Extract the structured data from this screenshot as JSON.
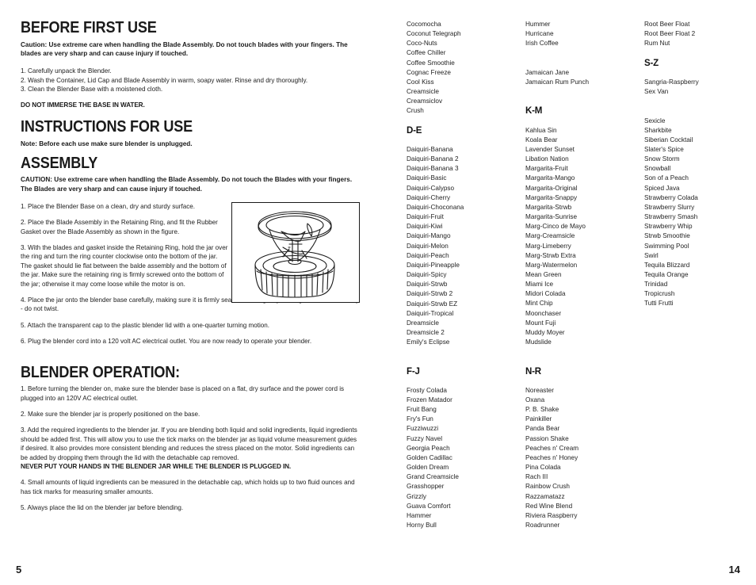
{
  "left_page": {
    "page_number": "5",
    "sections": [
      {
        "heading": "BEFORE FIRST USE",
        "caution": "Caution:  Use extreme care when handling the Blade Assembly.  Do not touch blades with your fingers. The blades are very sharp and can cause injury if touched.",
        "steps": [
          "1. Carefully unpack the Blender.",
          "2. Wash the Container, Lid Cap and Blade Assembly in warm, soapy water.  Rinse and dry thoroughly.",
          "3. Clean the Blender Base with a moistened cloth."
        ],
        "warning": "DO NOT IMMERSE THE BASE IN WATER."
      },
      {
        "heading": "INSTRUCTIONS FOR USE",
        "note": "Note:  Before each use make sure blender is unplugged."
      },
      {
        "heading": "ASSEMBLY",
        "caution": "CAUTION:   Use extreme care when handling the Blade Assembly.  Do not touch the Blades with your fingers.  The Blades are very sharp and can cause injury if touched.",
        "steps": [
          "1. Place the Blender Base on a clean, dry and sturdy surface.",
          "2. Place the Blade Assembly in the Retaining Ring, and fit the Rubber Gasket over the Blade Assembly as shown in the figure.",
          "3. With the blades and gasket inside the Retaining Ring, hold the jar over the ring and turn the ring counter clockwise onto the bottom of the jar. The gasket should lie flat between the balde assembly and the bottom of the jar.  Make sure the retaining ring is firmly screwed onto the bottom of the jar; otherwise it may come loose while the motor is on.",
          "4. Place the jar onto the blender base carefully, making sure it is firmly seated.  Use a gently rocking motion if necessary - do not twist.",
          "5. Attach the transparent cap to the plastic blender lid with a one-quarter turning motion.",
          "6. Plug the blender cord into a 120 volt AC electrical outlet.  You are now ready to operate your blender."
        ],
        "figure_caption": "blade-assembly-retaining-ring-gasket"
      },
      {
        "heading": "BLENDER OPERATION:",
        "steps": [
          "1.  Before turning the blender on, make sure the blender base is placed on a flat, dry surface and the power cord is plugged into an 120V AC electrical outlet.",
          "2.  Make sure the blender jar is properly positioned on the base.",
          "3.  Add the required ingredients to the blender jar. If you are blending both liquid and solid ingredients, liquid ingredients should be added first. This will allow you to use the tick marks on the blender jar as liquid volume measurement guides if desired. It also provides more consistent blending and reduces the stress placed on the motor. Solid ingredients can be added by dropping them through the lid with the detachable cap removed.",
          "4.  Small amounts of liquid ingredients can be measured in the detachable cap, which holds up to two fluid ounces and has tick marks for measuring smaller amounts.",
          "5.  Always place the lid on the blender jar before blending."
        ],
        "emphasis": "NEVER PUT YOUR HANDS IN THE BLENDER JAR WHILE THE BLENDER IS PLUGGED IN."
      }
    ]
  },
  "right_page": {
    "page_number": "14",
    "columns": [
      {
        "entries": [
          {
            "type": "drink",
            "text": "Cocomocha"
          },
          {
            "type": "drink",
            "text": "Coconut Telegraph"
          },
          {
            "type": "drink",
            "text": "Coco-Nuts"
          },
          {
            "type": "drink",
            "text": "Coffee Chiller"
          },
          {
            "type": "drink",
            "text": "Coffee Smoothie"
          },
          {
            "type": "drink",
            "text": "Cognac Freeze"
          },
          {
            "type": "drink",
            "text": "Cool Kiss"
          },
          {
            "type": "drink",
            "text": "Creamsicle"
          },
          {
            "type": "drink",
            "text": "Creamsiclov"
          },
          {
            "type": "drink",
            "text": "Crush"
          },
          {
            "type": "spacer"
          },
          {
            "type": "heading",
            "text": "D-E"
          },
          {
            "type": "spacer"
          },
          {
            "type": "drink",
            "text": "Daiquiri-Banana"
          },
          {
            "type": "drink",
            "text": "Daiquiri-Banana 2"
          },
          {
            "type": "drink",
            "text": "Daiquiri-Banana 3"
          },
          {
            "type": "drink",
            "text": "Daiquiri-Basic"
          },
          {
            "type": "drink",
            "text": "Daiquiri-Calypso"
          },
          {
            "type": "drink",
            "text": "Daiquiri-Cherry"
          },
          {
            "type": "drink",
            "text": "Daiquiri-Choconana"
          },
          {
            "type": "drink",
            "text": "Daiquiri-Fruit"
          },
          {
            "type": "drink",
            "text": "Daiquiri-Kiwi"
          },
          {
            "type": "drink",
            "text": "Daiquiri-Mango"
          },
          {
            "type": "drink",
            "text": "Daiquiri-Melon"
          },
          {
            "type": "drink",
            "text": "Daiquiri-Peach"
          },
          {
            "type": "drink",
            "text": "Daiquiri-Pineapple"
          },
          {
            "type": "drink",
            "text": "Daiquiri-Spicy"
          },
          {
            "type": "drink",
            "text": "Daiquiri-Strwb"
          },
          {
            "type": "drink",
            "text": "Daiquiri-Strwb 2"
          },
          {
            "type": "drink",
            "text": "Daiquiri-Strwb EZ"
          },
          {
            "type": "drink",
            "text": "Daiquiri-Tropical"
          },
          {
            "type": "drink",
            "text": "Dreamsicle"
          },
          {
            "type": "drink",
            "text": "Dreamsicle 2"
          },
          {
            "type": "drink",
            "text": "Emily's Eclipse"
          },
          {
            "type": "spacer"
          },
          {
            "type": "spacer"
          },
          {
            "type": "heading",
            "text": "F-J"
          },
          {
            "type": "spacer"
          },
          {
            "type": "drink",
            "text": "Frosty Colada"
          },
          {
            "type": "drink",
            "text": "Frozen Matador"
          },
          {
            "type": "drink",
            "text": "Fruit Bang"
          },
          {
            "type": "drink",
            "text": "Fry's Fun"
          },
          {
            "type": "drink",
            "text": "Fuzziwuzzi"
          },
          {
            "type": "drink",
            "text": "Fuzzy Navel"
          },
          {
            "type": "drink",
            "text": "Georgia Peach"
          },
          {
            "type": "drink",
            "text": "Golden Cadillac"
          },
          {
            "type": "drink",
            "text": "Golden Dream"
          },
          {
            "type": "drink",
            "text": "Grand Creamsicle"
          },
          {
            "type": "drink",
            "text": "Grasshopper"
          },
          {
            "type": "drink",
            "text": "Grizzly"
          },
          {
            "type": "drink",
            "text": "Guava Comfort"
          },
          {
            "type": "drink",
            "text": "Hammer"
          },
          {
            "type": "drink",
            "text": "Horny Bull"
          }
        ]
      },
      {
        "entries": [
          {
            "type": "drink",
            "text": "Hummer"
          },
          {
            "type": "drink",
            "text": "Hurricane"
          },
          {
            "type": "drink",
            "text": "Irish Coffee"
          },
          {
            "type": "spacer"
          },
          {
            "type": "spacer"
          },
          {
            "type": "drink",
            "text": "Jamaican Jane"
          },
          {
            "type": "drink",
            "text": "Jamaican Rum Punch"
          },
          {
            "type": "spacer"
          },
          {
            "type": "spacer"
          },
          {
            "type": "heading",
            "text": "K-M"
          },
          {
            "type": "spacer"
          },
          {
            "type": "drink",
            "text": "Kahlua Sin"
          },
          {
            "type": "drink",
            "text": "Koala Bear"
          },
          {
            "type": "drink",
            "text": "Lavender Sunset"
          },
          {
            "type": "drink",
            "text": "Libation Nation"
          },
          {
            "type": "drink",
            "text": "Margarita-Fruit"
          },
          {
            "type": "drink",
            "text": "Margarita-Mango"
          },
          {
            "type": "drink",
            "text": "Margarita-Original"
          },
          {
            "type": "drink",
            "text": "Margarita-Snappy"
          },
          {
            "type": "drink",
            "text": "Margarita-Strwb"
          },
          {
            "type": "drink",
            "text": "Margarita-Sunrise"
          },
          {
            "type": "drink",
            "text": "Marg-Cinco de Mayo"
          },
          {
            "type": "drink",
            "text": "Marg-Creamsicle"
          },
          {
            "type": "drink",
            "text": "Marg-Limeberry"
          },
          {
            "type": "drink",
            "text": "Marg-Strwb Extra"
          },
          {
            "type": "drink",
            "text": "Marg-Watermelon"
          },
          {
            "type": "drink",
            "text": "Mean Green"
          },
          {
            "type": "drink",
            "text": "Miami Ice"
          },
          {
            "type": "drink",
            "text": "Midori Colada"
          },
          {
            "type": "drink",
            "text": "Mint Chip"
          },
          {
            "type": "drink",
            "text": "Moonchaser"
          },
          {
            "type": "drink",
            "text": "Mount Fuji"
          },
          {
            "type": "drink",
            "text": "Muddy Moyer"
          },
          {
            "type": "drink",
            "text": "Mudslide"
          },
          {
            "type": "spacer"
          },
          {
            "type": "spacer"
          },
          {
            "type": "heading",
            "text": "N-R"
          },
          {
            "type": "spacer"
          },
          {
            "type": "drink",
            "text": "Noreaster"
          },
          {
            "type": "drink",
            "text": "Oxana"
          },
          {
            "type": "drink",
            "text": "P. B. Shake"
          },
          {
            "type": "drink",
            "text": "Painkiller"
          },
          {
            "type": "drink",
            "text": "Panda Bear"
          },
          {
            "type": "drink",
            "text": "Passion Shake"
          },
          {
            "type": "drink",
            "text": "Peaches n' Cream"
          },
          {
            "type": "drink",
            "text": "Peaches n' Honey"
          },
          {
            "type": "drink",
            "text": "Pina Colada"
          },
          {
            "type": "drink",
            "text": "Rach III"
          },
          {
            "type": "drink",
            "text": "Rainbow Crush"
          },
          {
            "type": "drink",
            "text": "Razzamatazz"
          },
          {
            "type": "drink",
            "text": "Red Wine Blend"
          },
          {
            "type": "drink",
            "text": "Riviera Raspberry"
          },
          {
            "type": "drink",
            "text": "Roadrunner"
          }
        ]
      },
      {
        "entries": [
          {
            "type": "drink",
            "text": "Root Beer Float"
          },
          {
            "type": "drink",
            "text": "Root Beer Float 2"
          },
          {
            "type": "drink",
            "text": "Rum Nut"
          },
          {
            "type": "spacer"
          },
          {
            "type": "heading",
            "text": "S-Z"
          },
          {
            "type": "spacer"
          },
          {
            "type": "drink",
            "text": "Sangria-Raspberry"
          },
          {
            "type": "drink",
            "text": "Sex Van"
          },
          {
            "type": "spacer"
          },
          {
            "type": "spacer"
          },
          {
            "type": "drink",
            "text": "Sexicle"
          },
          {
            "type": "drink",
            "text": "Sharkbite"
          },
          {
            "type": "drink",
            "text": "Siberian Cocktail"
          },
          {
            "type": "drink",
            "text": "Slater's Spice"
          },
          {
            "type": "drink",
            "text": "Snow Storm"
          },
          {
            "type": "drink",
            "text": "Snowball"
          },
          {
            "type": "drink",
            "text": "Son of a Peach"
          },
          {
            "type": "drink",
            "text": "Spiced Java"
          },
          {
            "type": "drink",
            "text": "Strawberry Colada"
          },
          {
            "type": "drink",
            "text": "Strawberry Slurry"
          },
          {
            "type": "drink",
            "text": "Strawberry Smash"
          },
          {
            "type": "drink",
            "text": "Strawberry Whip"
          },
          {
            "type": "drink",
            "text": "Strwb Smoothie"
          },
          {
            "type": "drink",
            "text": "Swimming Pool"
          },
          {
            "type": "drink",
            "text": "Swirl"
          },
          {
            "type": "drink",
            "text": "Tequila Blizzard"
          },
          {
            "type": "drink",
            "text": "Tequila Orange"
          },
          {
            "type": "drink",
            "text": "Trinidad"
          },
          {
            "type": "drink",
            "text": "Tropicrush"
          },
          {
            "type": "drink",
            "text": "Tutti Frutti"
          }
        ]
      }
    ]
  }
}
